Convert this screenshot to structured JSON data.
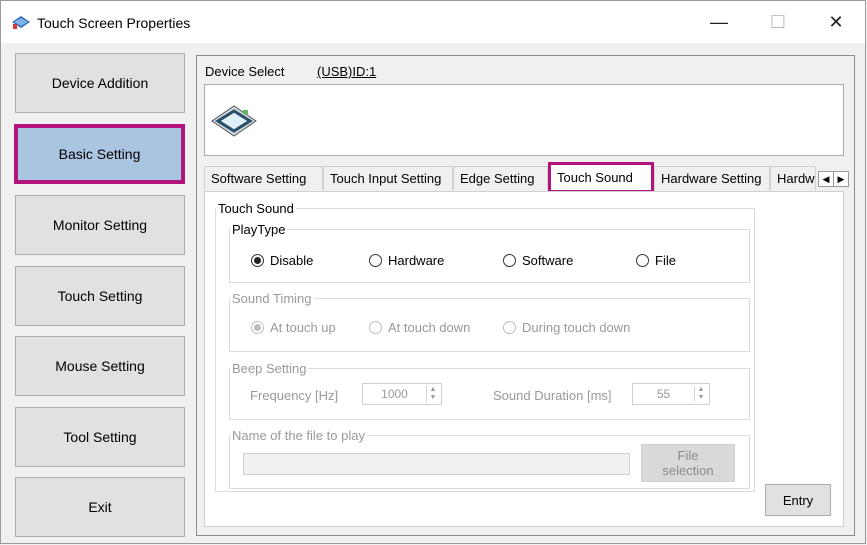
{
  "window": {
    "title": "Touch Screen Properties",
    "minimize_glyph": "—",
    "maximize_glyph": "☐",
    "close_glyph": "✕"
  },
  "sidebar": {
    "items": [
      {
        "label": "Device Addition",
        "active": false
      },
      {
        "label": "Basic Setting",
        "active": true
      },
      {
        "label": "Monitor Setting",
        "active": false
      },
      {
        "label": "Touch Setting",
        "active": false
      },
      {
        "label": "Mouse Setting",
        "active": false
      },
      {
        "label": "Tool Setting",
        "active": false
      },
      {
        "label": "Exit",
        "active": false
      }
    ]
  },
  "device": {
    "select_label": "Device Select",
    "select_value": "(USB)ID:1"
  },
  "tabs": [
    {
      "label": "Software Setting",
      "active": false
    },
    {
      "label": "Touch Input Setting",
      "active": false
    },
    {
      "label": "Edge Setting",
      "active": false
    },
    {
      "label": "Touch Sound",
      "active": true
    },
    {
      "label": "Hardware Setting",
      "active": false
    },
    {
      "label": "Hardwa",
      "active": false
    }
  ],
  "touch_sound": {
    "group_label": "Touch Sound",
    "playtype": {
      "label": "PlayType",
      "options": [
        "Disable",
        "Hardware",
        "Software",
        "File"
      ],
      "selected": "Disable"
    },
    "sound_timing": {
      "label": "Sound Timing",
      "options": [
        "At touch up",
        "At touch down",
        "During touch down"
      ],
      "selected": "At touch up"
    },
    "beep": {
      "label": "Beep Setting",
      "frequency_label": "Frequency [Hz]",
      "frequency_value": "1000",
      "duration_label": "Sound Duration [ms]",
      "duration_value": "55"
    },
    "file": {
      "label": "Name of the file to play",
      "value": "",
      "button_line1": "File",
      "button_line2": "selection"
    },
    "entry_label": "Entry"
  },
  "colors": {
    "highlight": "#b3137c",
    "active_button": "#aac5e0"
  }
}
